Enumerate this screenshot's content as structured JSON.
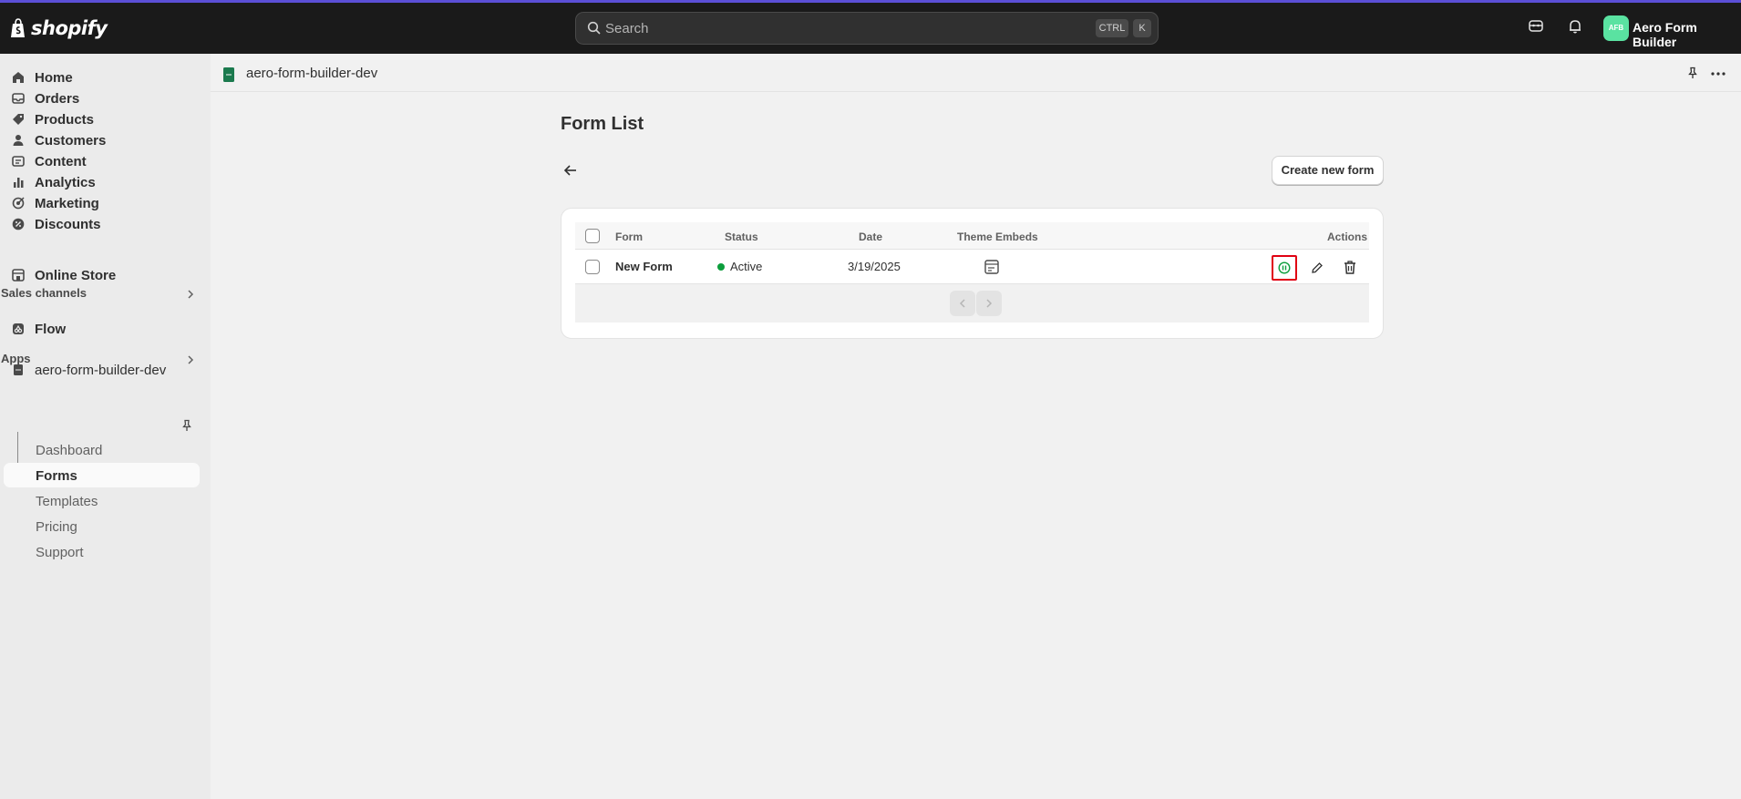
{
  "topbar": {
    "brand": "shopify",
    "search_placeholder": "Search",
    "shortcut_ctrl": "CTRL",
    "shortcut_k": "K",
    "avatar_initials": "AFB",
    "store_name": "Aero Form Builder"
  },
  "sidebar": {
    "items": [
      {
        "label": "Home",
        "icon": "home-icon"
      },
      {
        "label": "Orders",
        "icon": "orders-icon"
      },
      {
        "label": "Products",
        "icon": "tag-icon"
      },
      {
        "label": "Customers",
        "icon": "person-icon"
      },
      {
        "label": "Content",
        "icon": "content-icon"
      },
      {
        "label": "Analytics",
        "icon": "bar-chart-icon"
      },
      {
        "label": "Marketing",
        "icon": "target-icon"
      },
      {
        "label": "Discounts",
        "icon": "discount-icon"
      }
    ],
    "sales_channels_label": "Sales channels",
    "online_store_label": "Online Store",
    "apps_label": "Apps",
    "flow_label": "Flow",
    "app_name": "aero-form-builder-dev",
    "app_subitems": [
      "Dashboard",
      "Forms",
      "Templates",
      "Pricing",
      "Support"
    ],
    "active_subitem": "Forms"
  },
  "app_header": {
    "title": "aero-form-builder-dev"
  },
  "page": {
    "title": "Form List",
    "create_button": "Create new form"
  },
  "table": {
    "columns": [
      "Form",
      "Status",
      "Date",
      "Theme Embeds",
      "Actions"
    ],
    "rows": [
      {
        "form": "New Form",
        "status": "Active",
        "date": "3/19/2025"
      }
    ]
  },
  "colors": {
    "accent": "#5b4fd6",
    "status_active": "#0c9e3c",
    "highlight": "#e00012"
  }
}
